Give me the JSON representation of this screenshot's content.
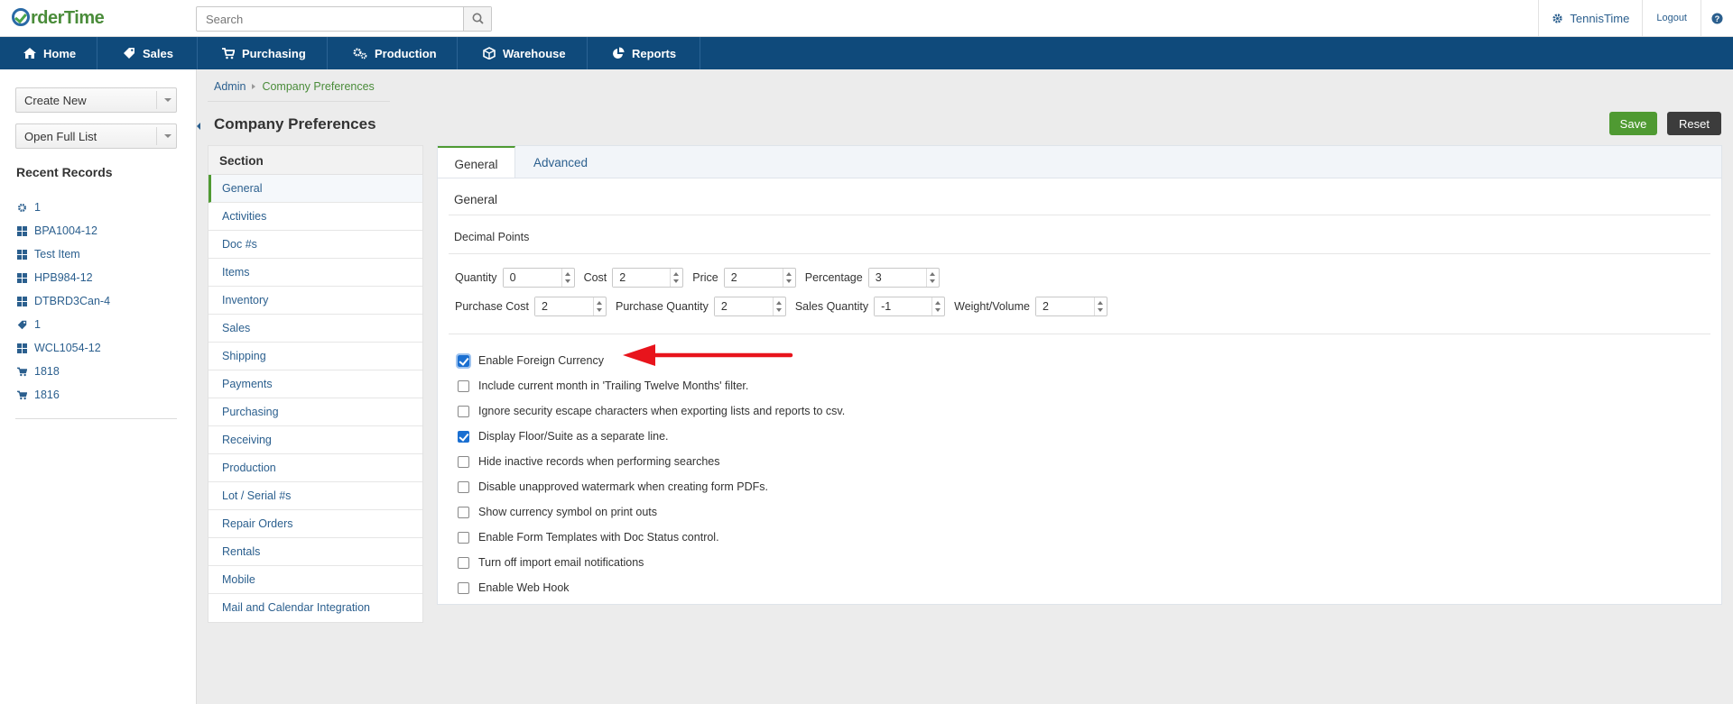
{
  "brand": {
    "logo_o": "O",
    "logo_rest": "rderTime"
  },
  "search": {
    "placeholder": "Search"
  },
  "top_right": {
    "company": "TennisTime",
    "logout": "Logout",
    "help": "?"
  },
  "nav": [
    {
      "label": "Home",
      "icon": "home-icon"
    },
    {
      "label": "Sales",
      "icon": "tag-icon"
    },
    {
      "label": "Purchasing",
      "icon": "cart-icon"
    },
    {
      "label": "Production",
      "icon": "gears-icon"
    },
    {
      "label": "Warehouse",
      "icon": "cube-icon"
    },
    {
      "label": "Reports",
      "icon": "pie-chart-icon"
    }
  ],
  "sidebar": {
    "create_new": "Create New",
    "open_full_list": "Open Full List",
    "recent_title": "Recent Records",
    "recent": [
      {
        "label": "1",
        "icon": "gear-icon"
      },
      {
        "label": "BPA1004-12",
        "icon": "grid-icon"
      },
      {
        "label": "Test Item",
        "icon": "grid-icon"
      },
      {
        "label": "HPB984-12",
        "icon": "grid-icon"
      },
      {
        "label": "DTBRD3Can-4",
        "icon": "grid-icon"
      },
      {
        "label": "1",
        "icon": "tag-icon"
      },
      {
        "label": "WCL1054-12",
        "icon": "grid-icon"
      },
      {
        "label": "1818",
        "icon": "cart-icon"
      },
      {
        "label": "1816",
        "icon": "cart-icon"
      }
    ]
  },
  "breadcrumb": {
    "parent": "Admin",
    "current": "Company Preferences"
  },
  "page": {
    "title": "Company Preferences",
    "save": "Save",
    "reset": "Reset"
  },
  "section": {
    "title": "Section",
    "items": [
      "General",
      "Activities",
      "Doc #s",
      "Items",
      "Inventory",
      "Sales",
      "Shipping",
      "Payments",
      "Purchasing",
      "Receiving",
      "Production",
      "Lot / Serial #s",
      "Repair Orders",
      "Rentals",
      "Mobile",
      "Mail and Calendar Integration"
    ],
    "active": "General"
  },
  "tabs": {
    "general": "General",
    "advanced": "Advanced"
  },
  "main": {
    "heading": "General",
    "decimal_title": "Decimal Points",
    "row1": [
      {
        "label": "Quantity",
        "value": "0"
      },
      {
        "label": "Cost",
        "value": "2"
      },
      {
        "label": "Price",
        "value": "2"
      },
      {
        "label": "Percentage",
        "value": "3"
      }
    ],
    "row2": [
      {
        "label": "Purchase Cost",
        "value": "2"
      },
      {
        "label": "Purchase Quantity",
        "value": "2"
      },
      {
        "label": "Sales Quantity",
        "value": "-1"
      },
      {
        "label": "Weight/Volume",
        "value": "2"
      }
    ],
    "options": [
      {
        "label": "Enable Foreign Currency",
        "checked": true
      },
      {
        "label": "Include current month in 'Trailing Twelve Months' filter.",
        "checked": false
      },
      {
        "label": "Ignore security escape characters when exporting lists and reports to csv.",
        "checked": false
      },
      {
        "label": "Display Floor/Suite as a separate line.",
        "checked": true
      },
      {
        "label": "Hide inactive records when performing searches",
        "checked": false
      },
      {
        "label": "Disable unapproved watermark when creating form PDFs.",
        "checked": false
      },
      {
        "label": "Show currency symbol on print outs",
        "checked": false
      },
      {
        "label": "Enable Form Templates with Doc Status control.",
        "checked": false
      },
      {
        "label": "Turn off import email notifications",
        "checked": false
      },
      {
        "label": "Enable Web Hook",
        "checked": false
      }
    ]
  },
  "colors": {
    "nav_bg": "#0f4a7b",
    "accent_green": "#4f9a32",
    "link_blue": "#2b5f8e",
    "annotation_red": "#e8141c"
  }
}
